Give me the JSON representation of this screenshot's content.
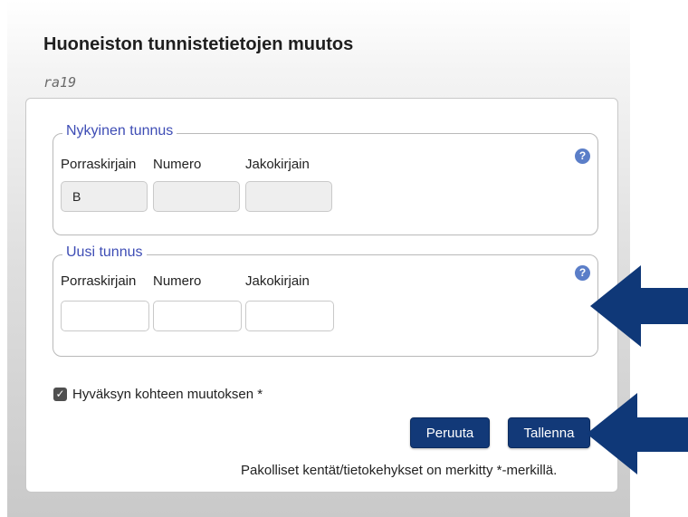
{
  "dialog": {
    "title": "Huoneiston tunnistetietojen muutos",
    "subtitle": "ra19"
  },
  "current_id": {
    "legend": "Nykyinen tunnus",
    "labels": [
      "Porraskirjain",
      "Numero",
      "Jakokirjain"
    ],
    "values": [
      "B",
      "",
      ""
    ]
  },
  "new_id": {
    "legend": "Uusi tunnus",
    "labels": [
      "Porraskirjain",
      "Numero",
      "Jakokirjain"
    ],
    "values": [
      "",
      "",
      ""
    ]
  },
  "help_icon": "?",
  "accept": {
    "checked": true,
    "label": "Hyväksyn kohteen muutoksen *"
  },
  "buttons": {
    "cancel": "Peruuta",
    "save": "Tallenna"
  },
  "footer_note": "Pakolliset kentät/tietokehykset on merkitty *-merkillä.",
  "colors": {
    "button": "#123978",
    "arrow": "#0f3878",
    "legend": "#3e4db5",
    "help_icon": "#5b7ec8"
  }
}
